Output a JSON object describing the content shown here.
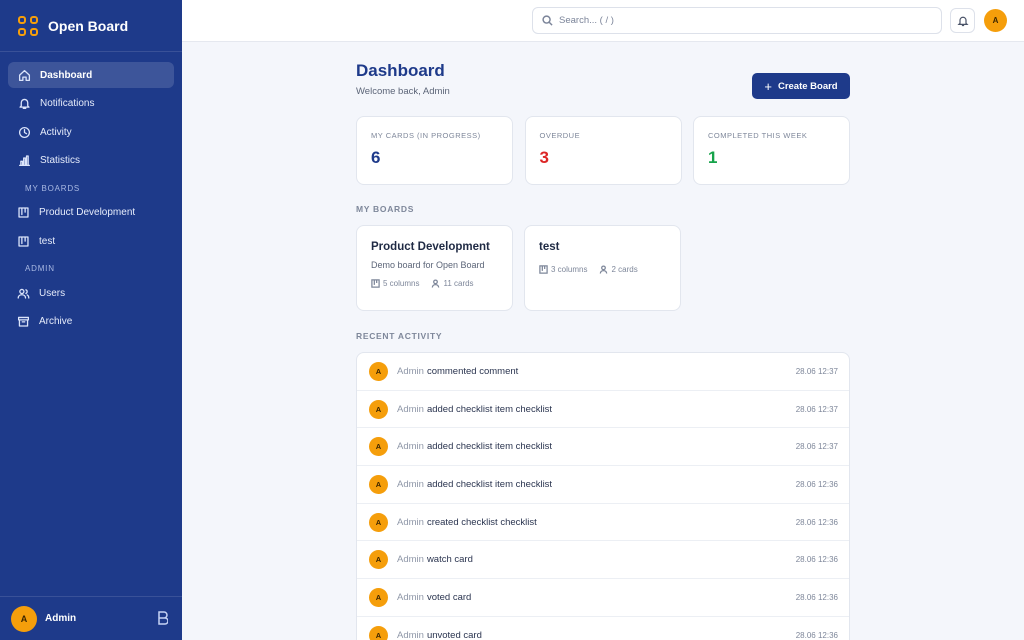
{
  "app": {
    "name": "Open Board"
  },
  "colors": {
    "sidebar": "#1e3a8a",
    "accent": "#f59e0b",
    "overdue": "#dc2626",
    "completed": "#16a34a",
    "primary": "#1e3a8a"
  },
  "sidebar": {
    "nav": [
      {
        "label": "Dashboard",
        "icon": "home-icon",
        "active": true
      },
      {
        "label": "Notifications",
        "icon": "bell-icon"
      },
      {
        "label": "Activity",
        "icon": "clock-icon"
      },
      {
        "label": "Statistics",
        "icon": "bar-chart-icon"
      }
    ],
    "my_boards_label": "MY BOARDS",
    "boards": [
      {
        "label": "Product Development",
        "icon": "board-icon"
      },
      {
        "label": "test",
        "icon": "board-icon"
      }
    ],
    "admin_label": "ADMIN",
    "admin": [
      {
        "label": "Users",
        "icon": "users-icon"
      },
      {
        "label": "Archive",
        "icon": "archive-icon"
      }
    ],
    "user": {
      "initial": "A",
      "name": "Admin"
    }
  },
  "topbar": {
    "search_placeholder": "Search... ( / )",
    "avatar_initial": "A"
  },
  "dashboard": {
    "title": "Dashboard",
    "subtitle": "Welcome back, Admin",
    "create_button": "Create Board",
    "stats": [
      {
        "label": "MY CARDS (IN PROGRESS)",
        "value": "6",
        "color": "#1e3a8a"
      },
      {
        "label": "OVERDUE",
        "value": "3",
        "color": "#dc2626"
      },
      {
        "label": "COMPLETED THIS WEEK",
        "value": "1",
        "color": "#16a34a"
      }
    ],
    "my_boards_title": "MY BOARDS",
    "boards": [
      {
        "title": "Product Development",
        "description": "Demo board for Open Board",
        "columns": "5 columns",
        "cards": "11 cards"
      },
      {
        "title": "test",
        "description": "",
        "columns": "3 columns",
        "cards": "2 cards"
      }
    ],
    "recent_activity_title": "RECENT ACTIVITY",
    "activity": [
      {
        "initial": "A",
        "user": "Admin",
        "text": "commented comment",
        "time": "28.06 12:37"
      },
      {
        "initial": "A",
        "user": "Admin",
        "text": "added checklist item checklist",
        "time": "28.06 12:37"
      },
      {
        "initial": "A",
        "user": "Admin",
        "text": "added checklist item checklist",
        "time": "28.06 12:37"
      },
      {
        "initial": "A",
        "user": "Admin",
        "text": "added checklist item checklist",
        "time": "28.06 12:36"
      },
      {
        "initial": "A",
        "user": "Admin",
        "text": "created checklist checklist",
        "time": "28.06 12:36"
      },
      {
        "initial": "A",
        "user": "Admin",
        "text": "watch card",
        "time": "28.06 12:36"
      },
      {
        "initial": "A",
        "user": "Admin",
        "text": "voted card",
        "time": "28.06 12:36"
      },
      {
        "initial": "A",
        "user": "Admin",
        "text": "unvoted card",
        "time": "28.06 12:36"
      }
    ]
  }
}
